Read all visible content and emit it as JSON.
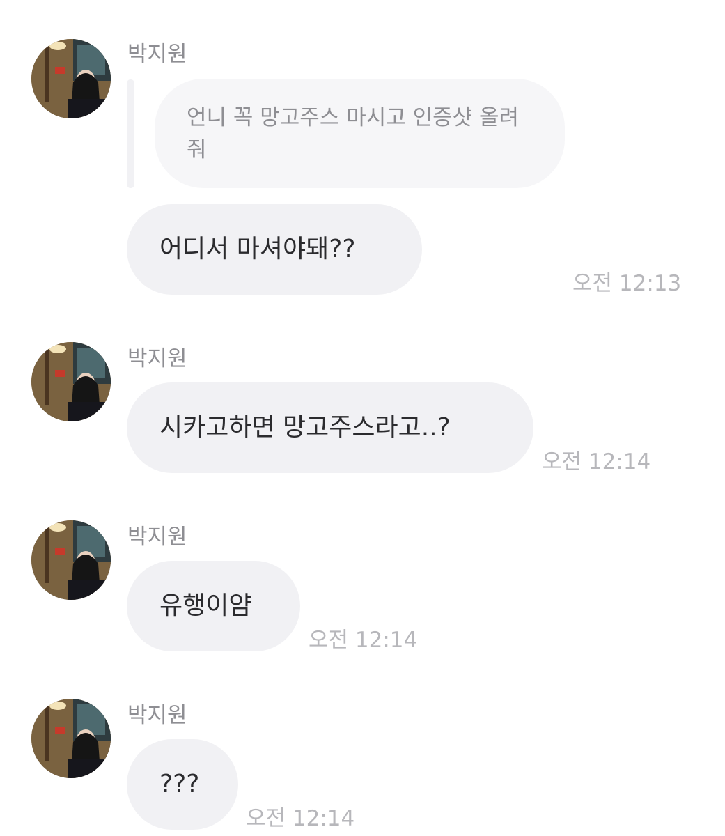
{
  "messages": [
    {
      "sender": "박지원",
      "reply_quote": "언니 꼭 망고주스 마시고 인증샷 올려줘",
      "text": "어디서 마셔야돼??",
      "time": "오전 12:13"
    },
    {
      "sender": "박지원",
      "text": "시카고하면 망고주스라고..?",
      "time": "오전 12:14"
    },
    {
      "sender": "박지원",
      "text": "유행이얌",
      "time": "오전 12:14"
    },
    {
      "sender": "박지원",
      "text": "???",
      "time": "오전 12:14"
    }
  ],
  "icons": {
    "avatar": "profile-photo"
  },
  "colors": {
    "bubble_bg": "#f1f1f4",
    "reply_bg": "#f6f6f8",
    "sender_text": "#8e8e93",
    "time_text": "#b7b7bb",
    "message_text": "#2b2b2e"
  }
}
